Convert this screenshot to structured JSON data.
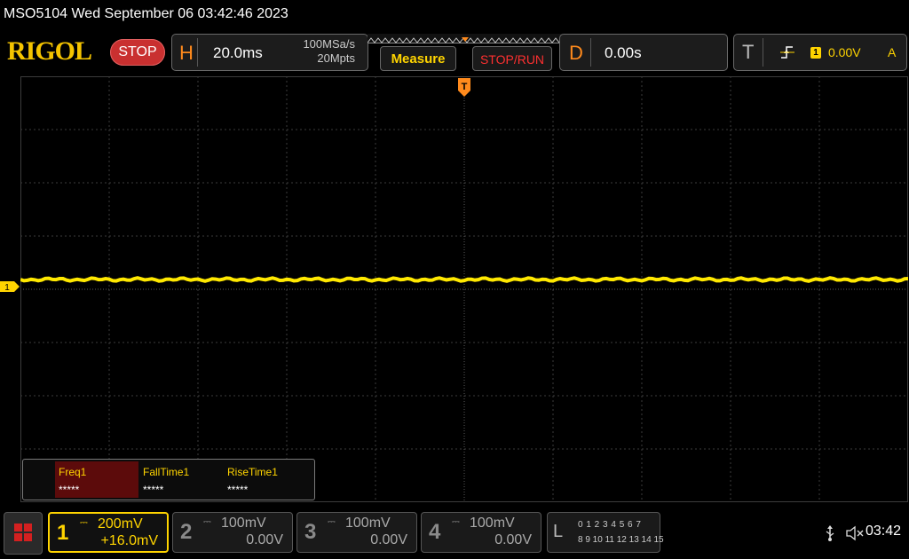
{
  "title": "MSO5104  Wed September 06 03:42:46 2023",
  "logo": "RIGOL",
  "run_state": "STOP",
  "horizontal": {
    "letter": "H",
    "timebase": "20.0ms",
    "sample_rate": "100MSa/s",
    "memory_depth": "20Mpts"
  },
  "buttons": {
    "measure": "Measure",
    "stop_run": "STOP/RUN"
  },
  "delay": {
    "letter": "D",
    "value": "0.00s"
  },
  "trigger": {
    "letter": "T",
    "source": "1",
    "level": "0.00V",
    "mode": "A",
    "marker": "T"
  },
  "channel_marker": "1",
  "measurements": [
    {
      "label": "Freq1",
      "value": "*****",
      "selected": true
    },
    {
      "label": "FallTime1",
      "value": "*****",
      "selected": false
    },
    {
      "label": "RiseTime1",
      "value": "*****",
      "selected": false
    }
  ],
  "channels": [
    {
      "num": "1",
      "scale": "200mV",
      "offset": "+16.0mV",
      "active": true,
      "color": "#ffd400"
    },
    {
      "num": "2",
      "scale": "100mV",
      "offset": "0.00V",
      "active": false,
      "color": "#9a9a9a"
    },
    {
      "num": "3",
      "scale": "100mV",
      "offset": "0.00V",
      "active": false,
      "color": "#9a9a9a"
    },
    {
      "num": "4",
      "scale": "100mV",
      "offset": "0.00V",
      "active": false,
      "color": "#9a9a9a"
    }
  ],
  "logic": {
    "letter": "L",
    "row1": "0 1 2 3   4 5 6 7",
    "row2": "8 9 10 11 12 13 14 15"
  },
  "clock": "03:42",
  "colors": {
    "accent_orange": "#ff8a1c",
    "trace_yellow": "#ffd400",
    "stop_red": "#c93030"
  }
}
